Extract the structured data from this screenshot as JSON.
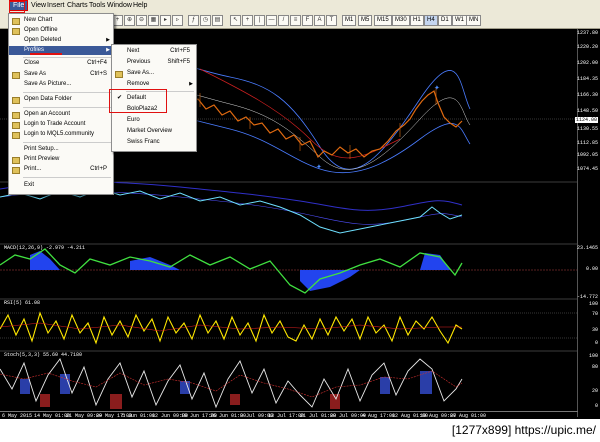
{
  "menubar": {
    "items": [
      "File",
      "View",
      "Insert",
      "Charts",
      "Tools",
      "Window",
      "Help"
    ]
  },
  "toolbar": {
    "timeframes": [
      "M1",
      "M5",
      "M15",
      "M30",
      "H1",
      "H4",
      "D1",
      "W1",
      "MN"
    ],
    "selected_timeframe": "H4"
  },
  "file_menu": {
    "items": [
      {
        "label": "New Chart",
        "shortcut": ""
      },
      {
        "label": "Open Offline",
        "shortcut": ""
      },
      {
        "label": "Open Deleted",
        "shortcut": "",
        "submenu": true
      },
      {
        "label": "Profiles",
        "shortcut": "",
        "submenu": true,
        "highlighted": true
      },
      {
        "label": "Close",
        "shortcut": "Ctrl+F4"
      },
      {
        "label": "Save As",
        "shortcut": "Ctrl+S"
      },
      {
        "label": "Save As Picture...",
        "shortcut": ""
      },
      {
        "label": "Open Data Folder",
        "shortcut": ""
      },
      {
        "label": "Open an Account",
        "shortcut": ""
      },
      {
        "label": "Login to Trade Account",
        "shortcut": ""
      },
      {
        "label": "Login to MQL5.community",
        "shortcut": ""
      },
      {
        "label": "Print Setup...",
        "shortcut": ""
      },
      {
        "label": "Print Preview",
        "shortcut": ""
      },
      {
        "label": "Print...",
        "shortcut": "Ctrl+P"
      },
      {
        "label": "Exit",
        "shortcut": ""
      }
    ]
  },
  "profiles_menu": {
    "items": [
      {
        "label": "Next",
        "shortcut": "Ctrl+F5"
      },
      {
        "label": "Previous",
        "shortcut": "Shift+F5"
      },
      {
        "label": "Save As...",
        "shortcut": ""
      },
      {
        "label": "Remove",
        "shortcut": "",
        "submenu": true
      },
      {
        "label": "Default",
        "shortcut": "",
        "checked": true
      },
      {
        "label": "BoloPlaza2",
        "shortcut": ""
      },
      {
        "label": "Euro",
        "shortcut": ""
      },
      {
        "label": "Market Overview",
        "shortcut": ""
      },
      {
        "label": "Swiss Franc",
        "shortcut": ""
      }
    ]
  },
  "price_axis": [
    "1237.80",
    "1220.20",
    "1202.00",
    "1184.35",
    "1166.30",
    "1148.50",
    "1130.55",
    "1112.85",
    "1092.05",
    "1074.45"
  ],
  "current_price": "1124.00",
  "indicators": {
    "macd_label": "MACD(12,26,9) -2.979 -4.211",
    "rsi_label": "RSI(5) 61.08",
    "stoch_label": "Stoch(5,3,3) 55.60 44.7180",
    "macd_axis": [
      "23.1465",
      "0.00",
      "-14.772"
    ],
    "rsi_axis": [
      "100",
      "70",
      "30",
      "0"
    ],
    "stoch_axis": [
      "100",
      "80",
      "20",
      "0"
    ]
  },
  "date_axis": [
    "6 May 2015",
    "14 May 01:00",
    "21 May 09:00",
    "29 May 17:00",
    "5 Jun 01:00",
    "12 Jun 09:00",
    "19 Jun 17:00",
    "26 Jun 01:00",
    "3 Jul 09:00",
    "13 Jul 17:00",
    "21 Jul 01:00",
    "28 Jul 09:00",
    "4 Aug 17:00",
    "12 Aug 01:00",
    "19 Aug 09:00",
    "27 Aug 01:00"
  ],
  "watermark": "[1277x899] https://upic.me/"
}
